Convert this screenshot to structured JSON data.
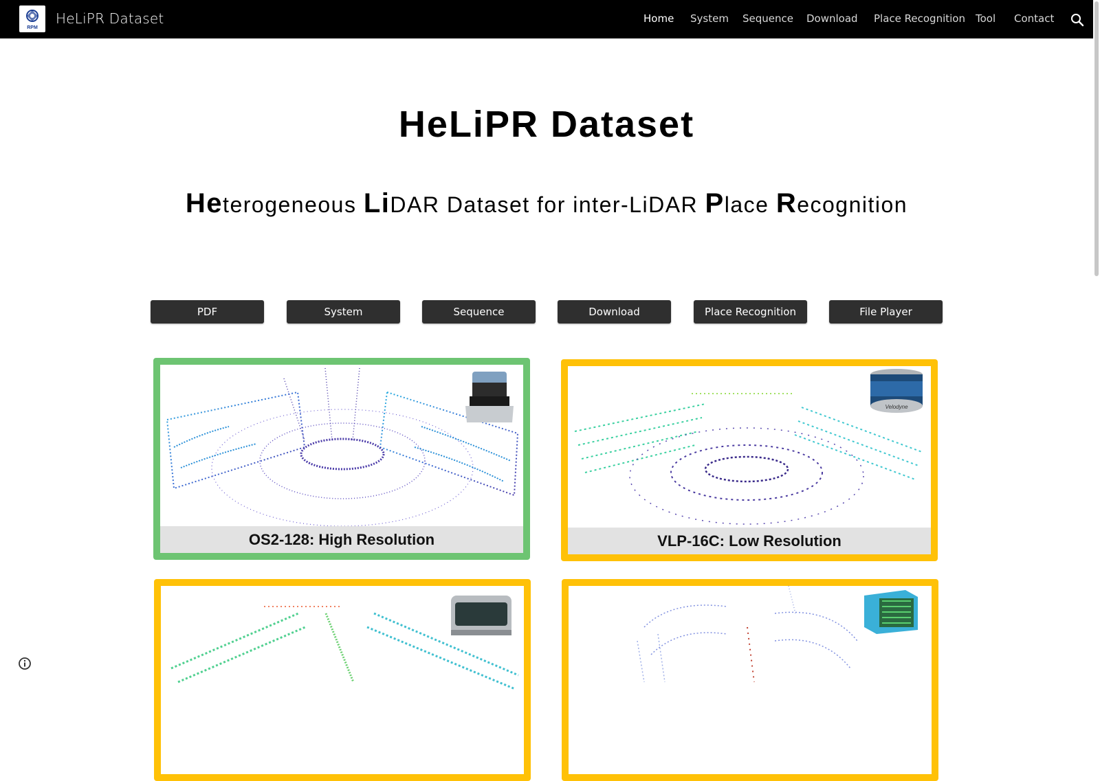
{
  "header": {
    "site_title": "HeLiPR Dataset",
    "logo_text": "RPM",
    "nav": [
      {
        "label": "Home",
        "active": true
      },
      {
        "label": "System",
        "active": false
      },
      {
        "label": "Sequence",
        "active": false
      },
      {
        "label": "Download",
        "active": false
      },
      {
        "label": "Place Recognition",
        "active": false
      },
      {
        "label": "Tool",
        "active": false
      },
      {
        "label": "Contact",
        "active": false
      }
    ],
    "search_icon": "search-icon"
  },
  "hero": {
    "title": "HeLiPR Dataset",
    "subtitle": {
      "p1_big": "He",
      "p1": "terogeneous ",
      "p2_big": "Li",
      "p2": "DAR Dataset for inter-LiDAR ",
      "p3_big": "P",
      "p3": "lace ",
      "p4_big": "R",
      "p4": "ecognition"
    }
  },
  "buttons": [
    "PDF",
    "System",
    "Sequence",
    "Download",
    "Place Recognition",
    "File Player"
  ],
  "cards": [
    {
      "caption": "OS2-128: High Resolution",
      "border_color": "#6dc472",
      "sensor_text": ""
    },
    {
      "caption": "VLP-16C: Low Resolution",
      "border_color": "#ffc107",
      "sensor_text": "Velodyne"
    },
    {
      "caption": "",
      "border_color": "#ffc107",
      "sensor_text": ""
    },
    {
      "caption": "",
      "border_color": "#ffc107",
      "sensor_text": ""
    }
  ],
  "footer": {
    "info_icon": "info-icon"
  }
}
